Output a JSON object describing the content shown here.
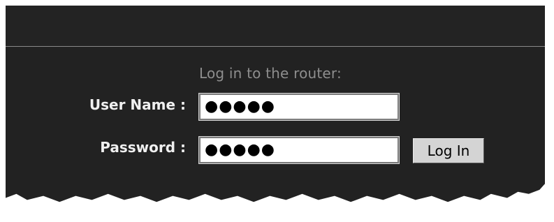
{
  "login": {
    "prompt": "Log in to the router:",
    "username_label": "User Name :",
    "username_value": "●●●●●",
    "password_label": "Password :",
    "password_value": "●●●●●",
    "submit_label": "Log In"
  },
  "colors": {
    "panel_background": "#222222",
    "divider": "#8a8a8a",
    "prompt_text": "#8e8e8e",
    "label_text": "#f0f0f0",
    "button_background": "#d4d4d4"
  }
}
